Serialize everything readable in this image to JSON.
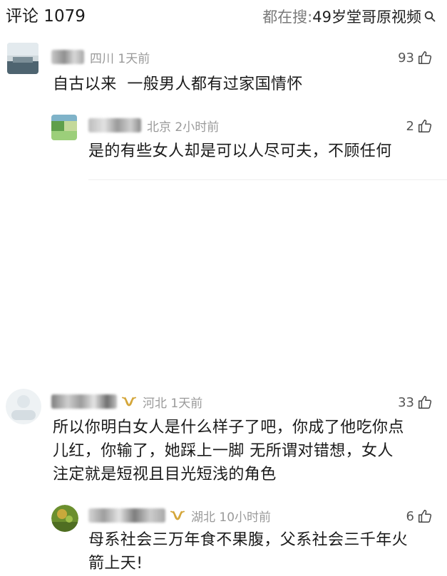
{
  "header": {
    "title": "评论 1079",
    "search_prefix": "都在搜: ",
    "search_term": "49岁堂哥原视频"
  },
  "comments": [
    {
      "name": "心悠",
      "location_time": "四川 1天前",
      "likes": "93",
      "text": "自古以来  一般男人都有过家国情怀",
      "reply": {
        "location_time": "北京 2小时前",
        "likes": "2",
        "text": "是的有些女人却是可以人尽可夫，不顾任何"
      }
    },
    {
      "location_time": "河北 1天前",
      "likes": "33",
      "text_lines": [
        "所以你明白女人是什么样子了吧，你成了他吃你点",
        "儿红，你输了，她踩上一脚 无所谓对错想，女人",
        "注定就是短视且目光短浅的角色"
      ],
      "reply": {
        "location_time": "湖北 10小时前",
        "likes": "6",
        "text_lines": [
          "母系社会三万年食不果腹，父系社会三千年火",
          "箭上天!"
        ]
      }
    }
  ],
  "icons": {
    "search": "search-icon",
    "like": "thumbs-up-icon",
    "badge": "vip-badge-icon"
  },
  "colors": {
    "meta_gray": "#9a9a9a",
    "badge_gold": "#d4a63a"
  }
}
